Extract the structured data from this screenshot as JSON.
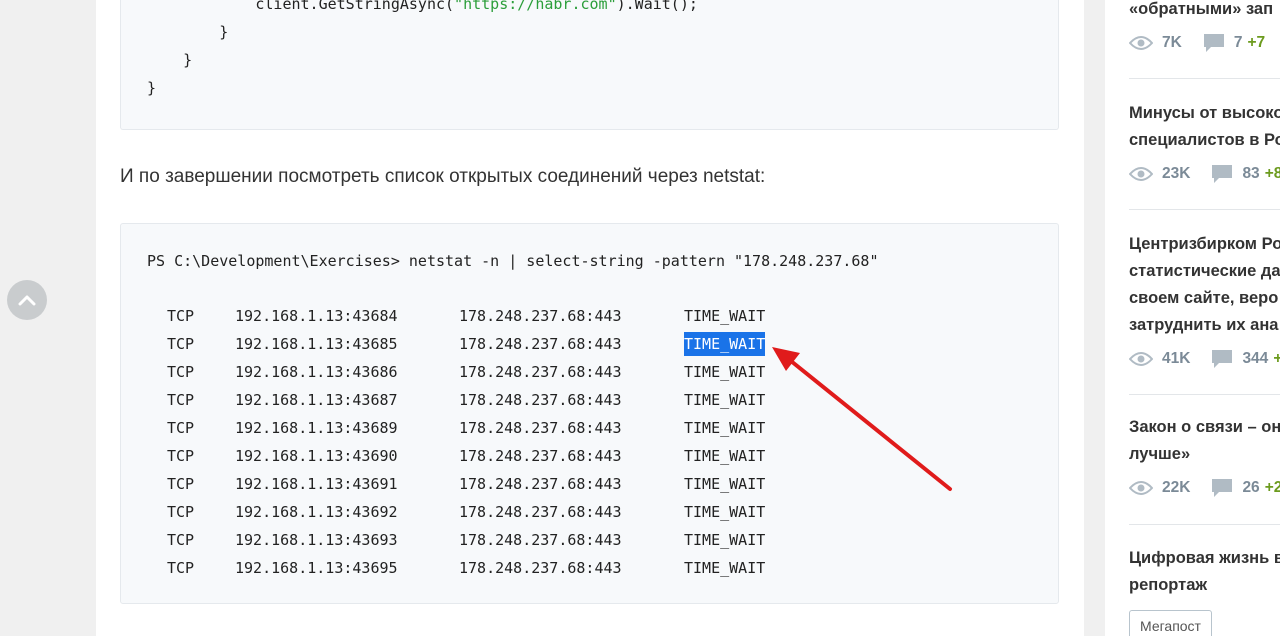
{
  "article": {
    "code_top": {
      "lines": [
        {
          "pre": "            client.GetStringAsync(",
          "str": "\"https://habr.com\"",
          "post": ").Wait();"
        },
        {
          "pre": "        }",
          "str": "",
          "post": ""
        },
        {
          "pre": "    }",
          "str": "",
          "post": ""
        },
        {
          "pre": "}",
          "str": "",
          "post": ""
        }
      ]
    },
    "paragraph": "И по завершении посмотреть список открытых соединений через netstat:",
    "netstat": {
      "command": "PS C:\\Development\\Exercises> netstat -n | select-string -pattern \"178.248.237.68\"",
      "rows": [
        {
          "proto": "TCP",
          "local": "192.168.1.13:43684",
          "remote": "178.248.237.68:443",
          "state": "TIME_WAIT"
        },
        {
          "proto": "TCP",
          "local": "192.168.1.13:43685",
          "remote": "178.248.237.68:443",
          "state": "TIME_WAIT"
        },
        {
          "proto": "TCP",
          "local": "192.168.1.13:43686",
          "remote": "178.248.237.68:443",
          "state": "TIME_WAIT"
        },
        {
          "proto": "TCP",
          "local": "192.168.1.13:43687",
          "remote": "178.248.237.68:443",
          "state": "TIME_WAIT"
        },
        {
          "proto": "TCP",
          "local": "192.168.1.13:43689",
          "remote": "178.248.237.68:443",
          "state": "TIME_WAIT"
        },
        {
          "proto": "TCP",
          "local": "192.168.1.13:43690",
          "remote": "178.248.237.68:443",
          "state": "TIME_WAIT"
        },
        {
          "proto": "TCP",
          "local": "192.168.1.13:43691",
          "remote": "178.248.237.68:443",
          "state": "TIME_WAIT"
        },
        {
          "proto": "TCP",
          "local": "192.168.1.13:43692",
          "remote": "178.248.237.68:443",
          "state": "TIME_WAIT"
        },
        {
          "proto": "TCP",
          "local": "192.168.1.13:43693",
          "remote": "178.248.237.68:443",
          "state": "TIME_WAIT"
        },
        {
          "proto": "TCP",
          "local": "192.168.1.13:43695",
          "remote": "178.248.237.68:443",
          "state": "TIME_WAIT"
        }
      ]
    }
  },
  "sidebar": {
    "posts": [
      {
        "title_lines": [
          "«обратными» зап"
        ],
        "views": "7K",
        "comments": "7",
        "plus": "+7"
      },
      {
        "title_lines": [
          "Минусы от высоко",
          "специалистов в Ро"
        ],
        "views": "23K",
        "comments": "83",
        "plus": "+8"
      },
      {
        "title_lines": [
          "Центризбирком Ро",
          "статистические да",
          "своем сайте, веро",
          "затруднить их ана"
        ],
        "views": "41K",
        "comments": "344",
        "plus": "+"
      },
      {
        "title_lines": [
          "Закон о связи – он",
          "лучше»"
        ],
        "views": "22K",
        "comments": "26",
        "plus": "+2"
      },
      {
        "title_lines": [
          "Цифровая жизнь в",
          "репортаж"
        ],
        "tag": "Мегапост"
      }
    ]
  },
  "colors": {
    "accent_green": "#6c9b1e",
    "highlight": "#1a73e8",
    "arrow": "#e01b1b",
    "string": "#2b9e3a"
  },
  "icons": [
    "eye-icon",
    "comment-icon",
    "arrow-up-icon"
  ]
}
